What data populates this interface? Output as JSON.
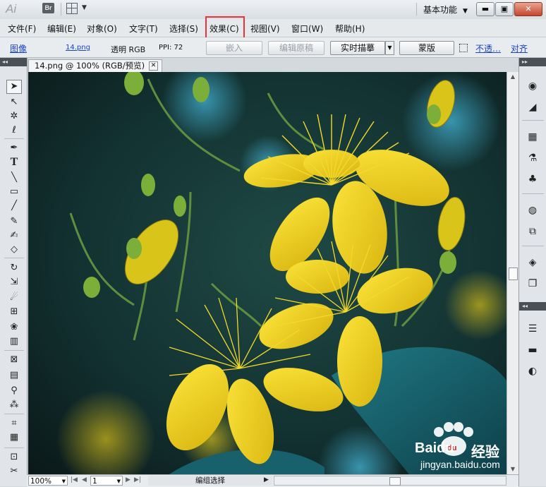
{
  "titlebar": {
    "app_logo": "Ai",
    "bridge_label": "Br",
    "workspace_label": "基本功能",
    "min_glyph": "▬",
    "max_glyph": "▣",
    "close_glyph": "✕"
  },
  "menubar": {
    "items": [
      "文件(F)",
      "编辑(E)",
      "对象(O)",
      "文字(T)",
      "选择(S)",
      "效果(C)",
      "视图(V)",
      "窗口(W)",
      "帮助(H)"
    ]
  },
  "controlbar": {
    "image_link": "图像",
    "filename_link": "14.png",
    "transparency_label": "透明 RGB",
    "ppi_label": "PPI: 72",
    "embed_button": "嵌入",
    "edit_original_button": "编辑原稿",
    "live_trace_button": "实时描摹",
    "mask_button": "蒙版",
    "opacity_link": "不透…",
    "align_link": "对齐"
  },
  "document": {
    "tab_title": "14.png @ 100% (RGB/预览)"
  },
  "statusbar": {
    "zoom_value": "100%",
    "page_value": "1",
    "status_text": "编组选择"
  },
  "watermark": {
    "brand": "Baidu",
    "brand_cn": "经验",
    "url": "jingyan.baidu.com"
  },
  "colors": {
    "highlight_box": "#e8343a",
    "link": "#1a43c8",
    "flower_yellow": "#f2d21b"
  },
  "icons": {
    "tools": [
      "selection-tool-icon",
      "direct-selection-tool-icon",
      "magic-wand-tool-icon",
      "lasso-tool-icon",
      "pen-tool-icon",
      "type-tool-icon",
      "line-tool-icon",
      "rectangle-tool-icon",
      "paintbrush-tool-icon",
      "pencil-tool-icon",
      "blob-brush-tool-icon",
      "eraser-tool-icon",
      "rotate-tool-icon",
      "scale-tool-icon",
      "warp-tool-icon",
      "free-transform-tool-icon",
      "symbol-sprayer-tool-icon",
      "column-graph-tool-icon",
      "mesh-tool-icon",
      "gradient-tool-icon",
      "eyedropper-tool-icon",
      "blend-tool-icon",
      "symbol-tool-icon",
      "graph-tool-icon",
      "artboard-tool-icon",
      "slice-tool-icon"
    ],
    "dock": [
      "color-panel-icon",
      "color-guide-icon",
      "swatches-icon",
      "brushes-icon",
      "symbols-icon",
      "graphic-styles-icon",
      "appearance-icon",
      "layers-icon",
      "artboards-icon",
      "stroke-icon",
      "gradient-icon",
      "transparency-icon"
    ]
  }
}
